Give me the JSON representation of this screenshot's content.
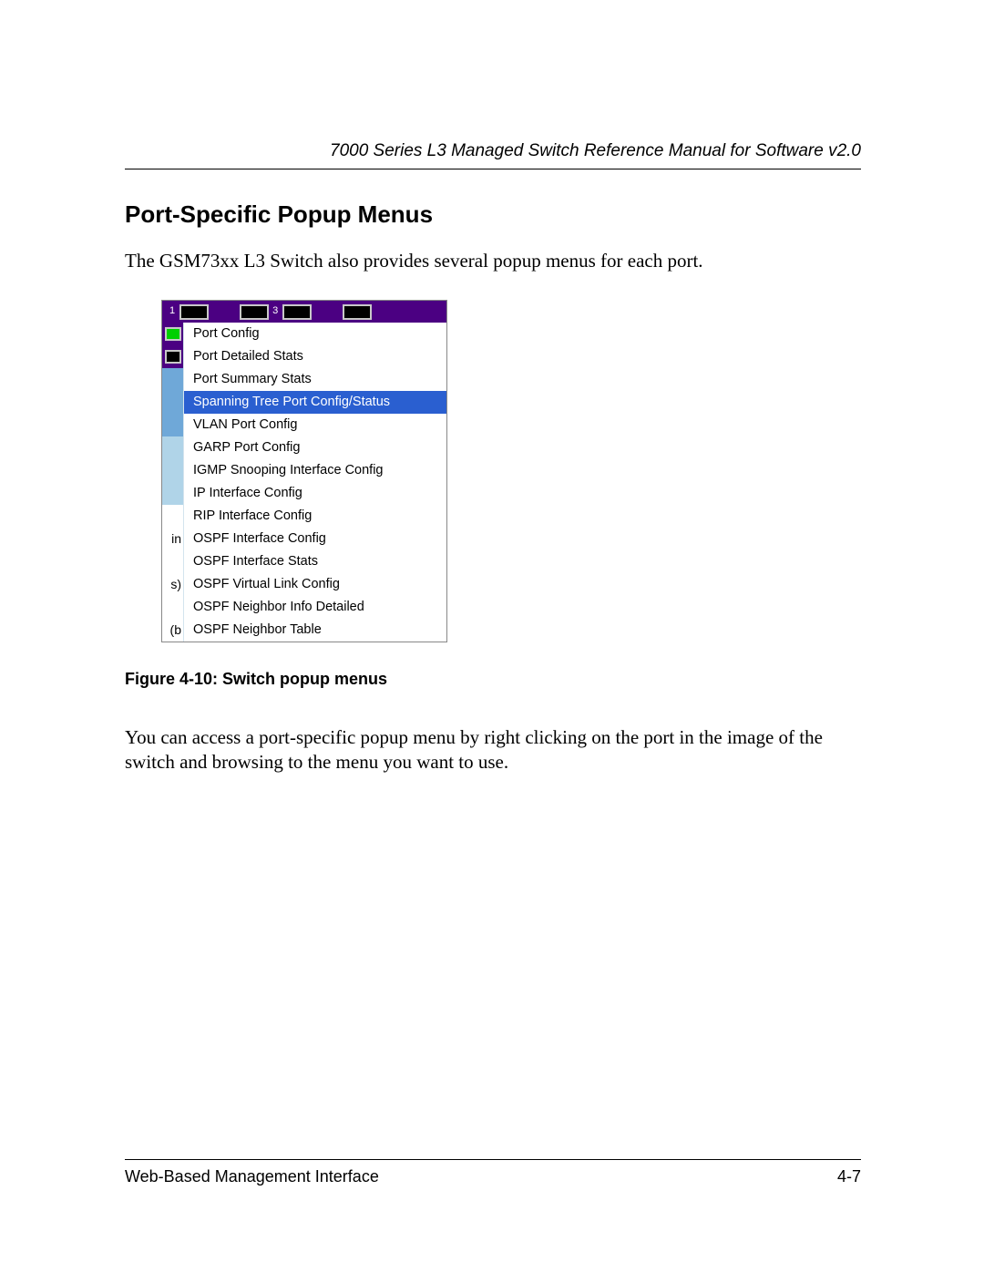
{
  "header": {
    "running_head": "7000 Series L3 Managed Switch Reference Manual for Software v2.0"
  },
  "section": {
    "title": "Port-Specific Popup Menus",
    "intro": "The GSM73xx L3 Switch also provides several popup menus for each port.",
    "figure_caption": "Figure 4-10:  Switch popup menus",
    "outro": "You can access a port-specific popup menu by right clicking on the port in the image of the switch and browsing to the menu you want to use."
  },
  "popup": {
    "selected_index": 3,
    "port_numbers": [
      "1",
      "3"
    ],
    "items": [
      "Port Config",
      "Port Detailed Stats",
      "Port Summary Stats",
      "Spanning Tree Port Config/Status",
      "VLAN Port Config",
      "GARP Port Config",
      "IGMP Snooping Interface Config",
      "IP Interface Config",
      "RIP Interface Config",
      "OSPF Interface Config",
      "OSPF Interface Stats",
      "OSPF Virtual Link Config",
      "OSPF Neighbor Info Detailed",
      "OSPF Neighbor Table"
    ],
    "left_strip": [
      {
        "type": "port_green"
      },
      {
        "type": "port_black"
      },
      {
        "type": "blue"
      },
      {
        "type": "blue"
      },
      {
        "type": "blue"
      },
      {
        "type": "lblue"
      },
      {
        "type": "lblue"
      },
      {
        "type": "lblue"
      },
      {
        "type": "white"
      },
      {
        "type": "text",
        "label": "in"
      },
      {
        "type": "white"
      },
      {
        "type": "text",
        "label": "s)"
      },
      {
        "type": "white"
      },
      {
        "type": "text",
        "label": "(b"
      }
    ]
  },
  "footer": {
    "left": "Web-Based Management Interface",
    "right": "4-7"
  }
}
